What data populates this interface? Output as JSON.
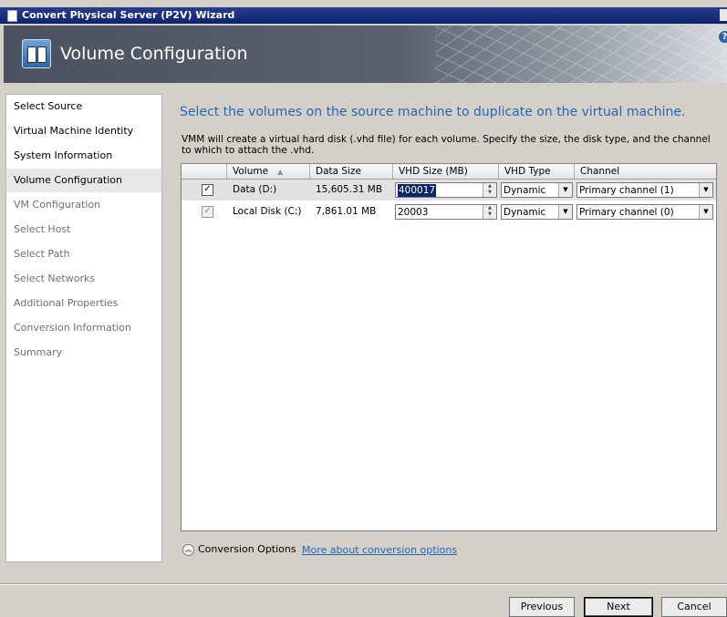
{
  "window": {
    "title": "Convert Physical Server (P2V) Wizard"
  },
  "banner": {
    "title": "Volume Configuration",
    "help_label": "?"
  },
  "sidebar": {
    "items": [
      {
        "label": "Select Source",
        "state": "done"
      },
      {
        "label": "Virtual Machine Identity",
        "state": "done"
      },
      {
        "label": "System Information",
        "state": "done"
      },
      {
        "label": "Volume Configuration",
        "state": "current"
      },
      {
        "label": "VM Configuration",
        "state": "pending"
      },
      {
        "label": "Select Host",
        "state": "pending"
      },
      {
        "label": "Select Path",
        "state": "pending"
      },
      {
        "label": "Select Networks",
        "state": "pending"
      },
      {
        "label": "Additional Properties",
        "state": "pending"
      },
      {
        "label": "Conversion Information",
        "state": "pending"
      },
      {
        "label": "Summary",
        "state": "pending"
      }
    ]
  },
  "main": {
    "heading": "Select the volumes on the source machine to duplicate on the virtual machine.",
    "description": "VMM will create a virtual hard disk (.vhd file) for each volume. Specify the size, the disk type, and the channel to which to attach the .vhd.",
    "table": {
      "columns": [
        "Volume",
        "Data Size",
        "VHD Size (MB)",
        "VHD Type",
        "Channel"
      ],
      "rows": [
        {
          "checked": true,
          "volume": "Data (D:)",
          "data_size": "15,605.31 MB",
          "vhd_size": "400017",
          "vhd_type": "Dynamic",
          "channel": "Primary channel (1)"
        },
        {
          "checked": true,
          "volume": "Local Disk (C:)",
          "data_size": "7,861.01 MB",
          "vhd_size": "20003",
          "vhd_type": "Dynamic",
          "channel": "Primary channel (0)"
        }
      ]
    },
    "conversion_options_label": "Conversion Options",
    "more_link": "More about conversion options"
  },
  "footer": {
    "previous": "Previous",
    "next": "Next",
    "cancel": "Cancel"
  },
  "colors": {
    "heading": "#2266bb",
    "link": "#2266bb",
    "titlebar": "#0a2470"
  },
  "icons": [
    "window-icon",
    "wizard-icon",
    "help-icon",
    "sort-asc-icon",
    "spin-up-icon",
    "spin-down-icon",
    "dropdown-arrow-icon",
    "expand-chevron-icon"
  ]
}
